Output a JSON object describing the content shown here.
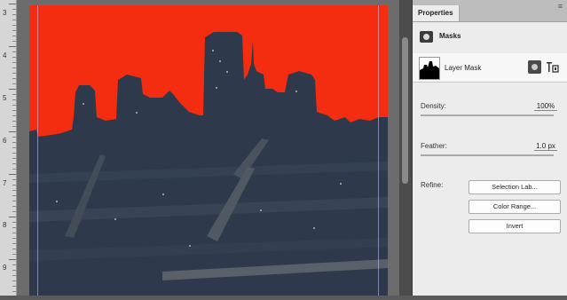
{
  "ruler": {
    "numbers": [
      "3",
      "4",
      "5",
      "6",
      "7",
      "8",
      "9"
    ]
  },
  "properties": {
    "tab_label": "Properties",
    "menu_icon": "panel-menu-icon",
    "masks_label": "Masks",
    "layer_mask_label": "Layer Mask",
    "density": {
      "label": "Density:",
      "value": "100%",
      "level": 1.0
    },
    "feather": {
      "label": "Feather:",
      "value": "1.0 px",
      "level": 0.0
    },
    "refine_label": "Refine:",
    "buttons": {
      "selection": "Selection Lab...",
      "color_range": "Color Range...",
      "invert": "Invert"
    }
  },
  "colors": {
    "mask_overlay": "#f42d10",
    "city_dark": "#2e3a4c",
    "panel_bg": "#ececec"
  }
}
